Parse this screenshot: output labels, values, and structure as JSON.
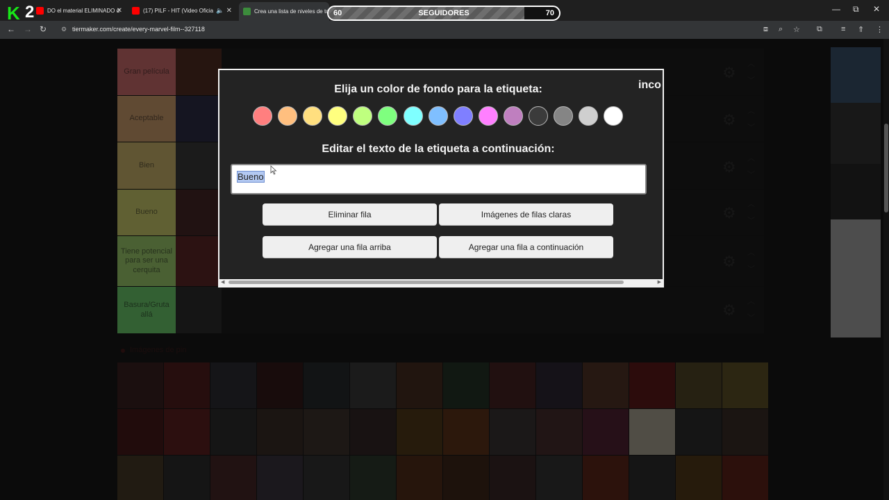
{
  "browser": {
    "tabs": [
      {
        "title": "DO el material ELIMINADO d",
        "favicon_color": "#ff0000"
      },
      {
        "title": "(17) PILF - HIT (Video Oficia",
        "favicon_color": "#ff0000"
      },
      {
        "title": "Crea una lista de niveles de tod",
        "favicon_color": "#3c8c3c"
      }
    ],
    "url": "tiermaker.com/create/every-marvel-film--327118",
    "window_controls": {
      "minimize": "—",
      "maximize": "⧉",
      "close": "✕"
    }
  },
  "overlay": {
    "logo_k": "K",
    "logo_2": "2",
    "followers": {
      "start": "60",
      "label": "SEGUIDORES",
      "goal": "70",
      "progress_fraction": 0.85
    }
  },
  "tiers": [
    {
      "label": "Gran película",
      "color": "#ff7f7f"
    },
    {
      "label": "Aceptable",
      "color": "#ffbf7f"
    },
    {
      "label": "Bien",
      "color": "#ffdf7f"
    },
    {
      "label": "Bueno",
      "color": "#ffff7f"
    },
    {
      "label": "Tiene potencial para ser una cerquita",
      "color": "#bfff7f"
    },
    {
      "label": "Basura/Gruta allá",
      "color": "#7fff7f"
    }
  ],
  "pool": {
    "title": "Imágenes de pin"
  },
  "modal": {
    "title": "Elija un color de fondo para la etiqueta:",
    "cut_text": "inco",
    "swatches": [
      "#ff7f7f",
      "#ffbf7f",
      "#ffdf7f",
      "#ffff7f",
      "#bfff7f",
      "#7fff7f",
      "#7fffff",
      "#7fbfff",
      "#7f7fff",
      "#ff7fff",
      "#bf7fbf",
      "#3b3b3b",
      "#858585",
      "#cfcfcf",
      "#ffffff"
    ],
    "subtitle": "Editar el texto de la etiqueta a continuación:",
    "label_value": "Bueno",
    "buttons": {
      "delete_row": "Eliminar fila",
      "clear_images": "Imágenes de filas claras",
      "add_above": "Agregar una fila arriba",
      "add_below": "Agregar una fila a continuación"
    }
  }
}
